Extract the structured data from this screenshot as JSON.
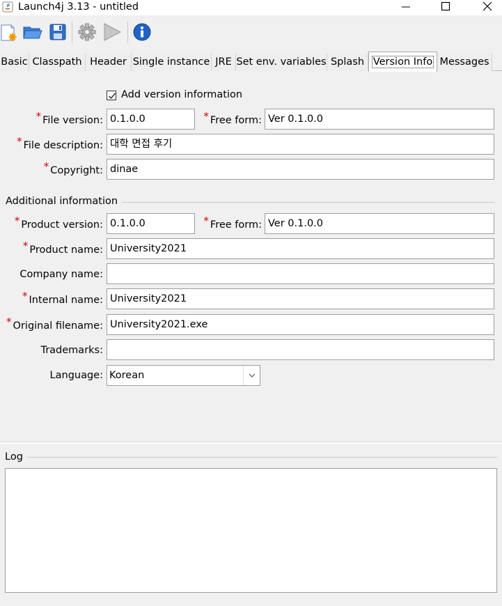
{
  "window": {
    "title": "Launch4j 3.13 - untitled",
    "controls": [
      "minimize",
      "maximize",
      "close"
    ]
  },
  "toolbar": {
    "icons": [
      "new-config-icon",
      "open-folder-icon",
      "save-icon",
      "build-gear-icon",
      "run-play-icon",
      "about-info-icon"
    ]
  },
  "tabs": [
    {
      "label": "Basic"
    },
    {
      "label": "Classpath"
    },
    {
      "label": "Header"
    },
    {
      "label": "Single instance"
    },
    {
      "label": "JRE"
    },
    {
      "label": "Set env. variables"
    },
    {
      "label": "Splash"
    },
    {
      "label": "Version Info",
      "selected": true
    },
    {
      "label": "Messages"
    }
  ],
  "version_info": {
    "checkbox_label": "Add version information",
    "checkbox_checked": true,
    "required_mark": "*",
    "file_version": {
      "label": "File version:",
      "value": "0.1.0.0"
    },
    "file_free_form": {
      "label": "Free form:",
      "value": "Ver 0.1.0.0"
    },
    "file_description": {
      "label": "File description:",
      "value": "대학 면접 후기"
    },
    "copyright": {
      "label": "Copyright:",
      "value": "dinae"
    }
  },
  "additional": {
    "title": "Additional information",
    "product_version": {
      "label": "Product version:",
      "value": "0.1.0.0"
    },
    "product_free_form": {
      "label": "Free form:",
      "value": "Ver 0.1.0.0"
    },
    "product_name": {
      "label": "Product name:",
      "value": "University2021"
    },
    "company_name": {
      "label": "Company name:",
      "value": ""
    },
    "internal_name": {
      "label": "Internal name:",
      "value": "University2021"
    },
    "original_filename": {
      "label": "Original filename:",
      "value": "University2021.exe"
    },
    "trademarks": {
      "label": "Trademarks:",
      "value": ""
    },
    "language": {
      "label": "Language:",
      "value": "Korean"
    }
  },
  "log": {
    "title": "Log",
    "content": ""
  },
  "colors": {
    "required": "#d40000",
    "background": "#f0f0f0"
  }
}
